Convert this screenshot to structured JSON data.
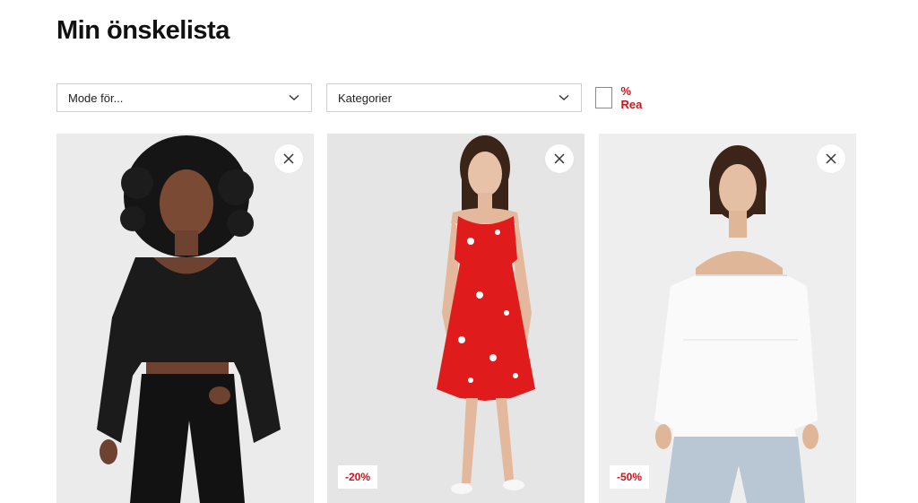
{
  "page": {
    "title": "Min önskelista"
  },
  "filters": {
    "gender": {
      "label": "Mode för..."
    },
    "category": {
      "label": "Kategorier"
    },
    "sale": {
      "label": "% Rea",
      "checked": false
    }
  },
  "products": [
    {
      "discount": "",
      "remove_icon": "close-icon"
    },
    {
      "discount": "-20%",
      "remove_icon": "close-icon"
    },
    {
      "discount": "-50%",
      "remove_icon": "close-icon"
    }
  ],
  "colors": {
    "sale_red": "#d0121b",
    "card_bg": "#ececec"
  }
}
